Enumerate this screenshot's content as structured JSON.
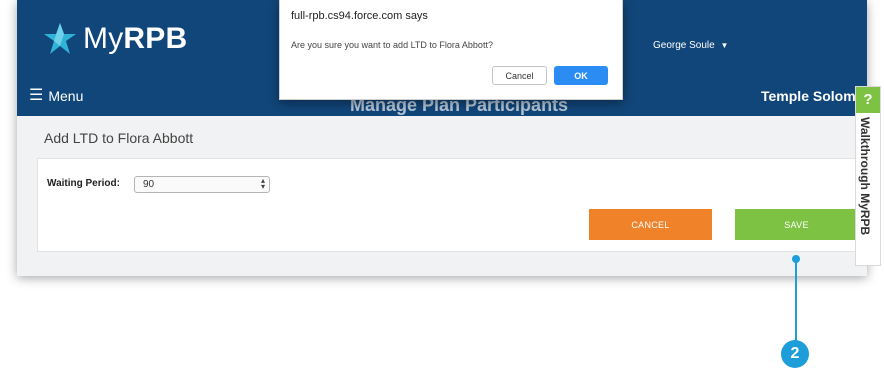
{
  "header": {
    "logo_prefix": "My",
    "logo_brand": "RPB",
    "user_name": "George Soule",
    "user_caret": "▼",
    "menu_label": "Menu",
    "menu_icon": "☰",
    "page_title": "Manage Plan Participants",
    "org_name": "Temple Solom",
    "colors": {
      "header_bg": "#11467a",
      "accent_green": "#7dc243",
      "accent_orange": "#f0832a"
    }
  },
  "section": {
    "title": "Add LTD to Flora Abbott"
  },
  "form": {
    "waiting_period_label": "Waiting Period:",
    "waiting_period_value": "90",
    "cancel_label": "CANCEL",
    "save_label": "SAVE"
  },
  "walkthrough": {
    "icon": "?",
    "label": "Walkthrough MyRPB"
  },
  "dialog": {
    "title": "full-rpb.cs94.force.com says",
    "message": "Are you sure you want to add LTD to Flora Abbott?",
    "cancel_label": "Cancel",
    "ok_label": "OK"
  },
  "callout": {
    "number": "2",
    "color": "#1d9ed9"
  }
}
